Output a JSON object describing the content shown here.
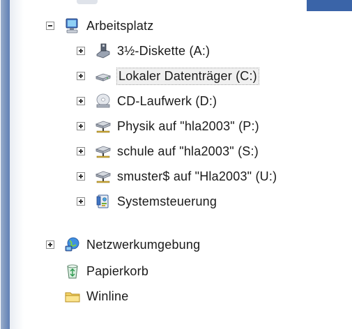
{
  "tree": {
    "root": {
      "label": "Arbeitsplatz",
      "expanded": true,
      "icon": "computer-icon",
      "children": [
        {
          "label": "3½-Diskette (A:)",
          "icon": "floppy-drive-icon"
        },
        {
          "label": "Lokaler Datenträger (C:)",
          "icon": "hard-drive-icon",
          "selected": true
        },
        {
          "label": "CD-Laufwerk (D:)",
          "icon": "cd-drive-icon"
        },
        {
          "label": "Physik auf \"hla2003\" (P:)",
          "icon": "network-drive-icon"
        },
        {
          "label": "schule auf \"hla2003\" (S:)",
          "icon": "network-drive-icon"
        },
        {
          "label": "smuster$ auf \"Hla2003\" (U:)",
          "icon": "network-drive-icon"
        },
        {
          "label": "Systemsteuerung",
          "icon": "control-panel-icon"
        }
      ]
    },
    "siblings": [
      {
        "label": "Netzwerkumgebung",
        "icon": "network-places-icon",
        "expandable": true
      },
      {
        "label": "Papierkorb",
        "icon": "recycle-bin-icon",
        "expandable": false
      },
      {
        "label": "Winline",
        "icon": "folder-icon",
        "expandable": false
      }
    ]
  },
  "colors": {
    "left_bar": "#6f8dbd",
    "top_tab": "#3a64a8",
    "selection_bg": "#f0f0f0"
  }
}
